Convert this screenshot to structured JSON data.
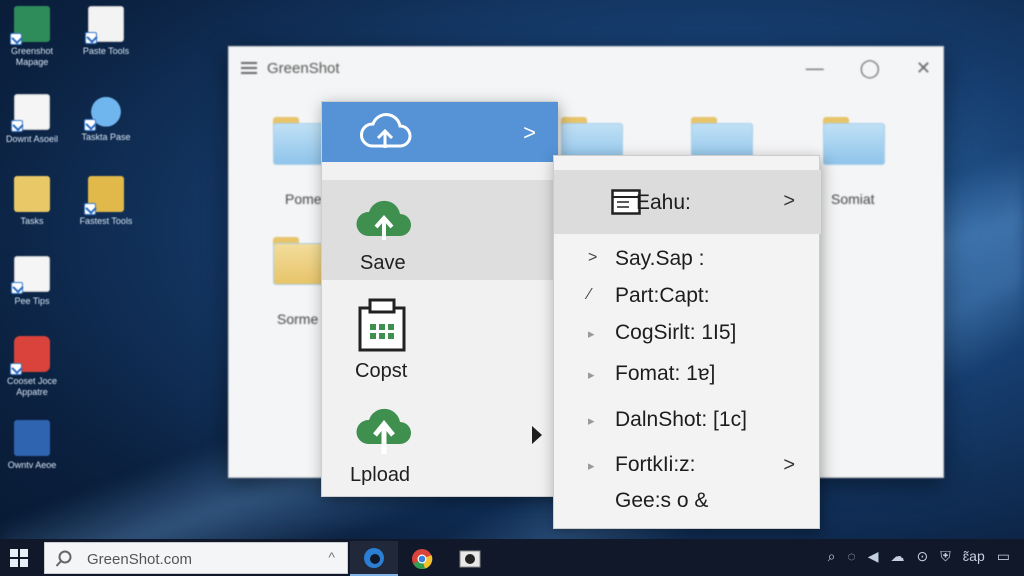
{
  "desktop": {
    "icons": [
      {
        "label": "Greenshot Mapage",
        "icon": "app-icon"
      },
      {
        "label": "Paste Tools",
        "icon": "document-icon"
      },
      {
        "label": "Downt Asoeil",
        "icon": "chart-doc-icon"
      },
      {
        "label": "Taskta Pase",
        "icon": "cloud-icon"
      },
      {
        "label": "Tasks",
        "icon": "folder-icon"
      },
      {
        "label": "Fastest Tools",
        "icon": "folder-icon"
      },
      {
        "label": "Pee Tips",
        "icon": "document-icon"
      },
      {
        "label": "Cooset Joce Appatre",
        "icon": "app-red-icon"
      },
      {
        "label": "Owntv Aeoe",
        "icon": "app-blue-icon"
      }
    ]
  },
  "window": {
    "title": "GreenShot",
    "controls": {
      "minimize": "—",
      "maximize": "◯",
      "close": "✕"
    },
    "folders": [
      {
        "label": "Pome"
      },
      {
        "label": "Somiat"
      },
      {
        "label": "Sorme"
      }
    ]
  },
  "menu": {
    "header_icon": "cloud-upload-icon",
    "header_chevron": ">",
    "items": [
      {
        "label": "Save",
        "icon": "cloud-upload-icon"
      },
      {
        "label": "Copst",
        "icon": "clipboard-icon"
      },
      {
        "label": "Lpload",
        "icon": "cloud-upload-icon"
      }
    ]
  },
  "submenu": {
    "header": {
      "label": "Eahu:",
      "chevron": ">"
    },
    "items": [
      {
        "mark": ">",
        "label": "Say.Sap :"
      },
      {
        "mark": "⁄",
        "label": "Part:Capt:"
      },
      {
        "mark": "▸",
        "label": "CogSirlt: 1I5]"
      },
      {
        "mark": "▸",
        "label": "Fomat: 1ɐ]"
      },
      {
        "mark": "▸",
        "label": "DalnShot: [1c]"
      },
      {
        "mark": "▸",
        "label": "FortkIi:z:",
        "chevron": ">"
      },
      {
        "mark": "",
        "label": "Gee:s o &"
      }
    ]
  },
  "taskbar": {
    "search_text": "GreenShot.com",
    "search_caret": "^",
    "tray_text": "ɛ̃ap"
  },
  "colors": {
    "menu_header": "#5593d6",
    "icon_green": "#3f8f4e"
  }
}
